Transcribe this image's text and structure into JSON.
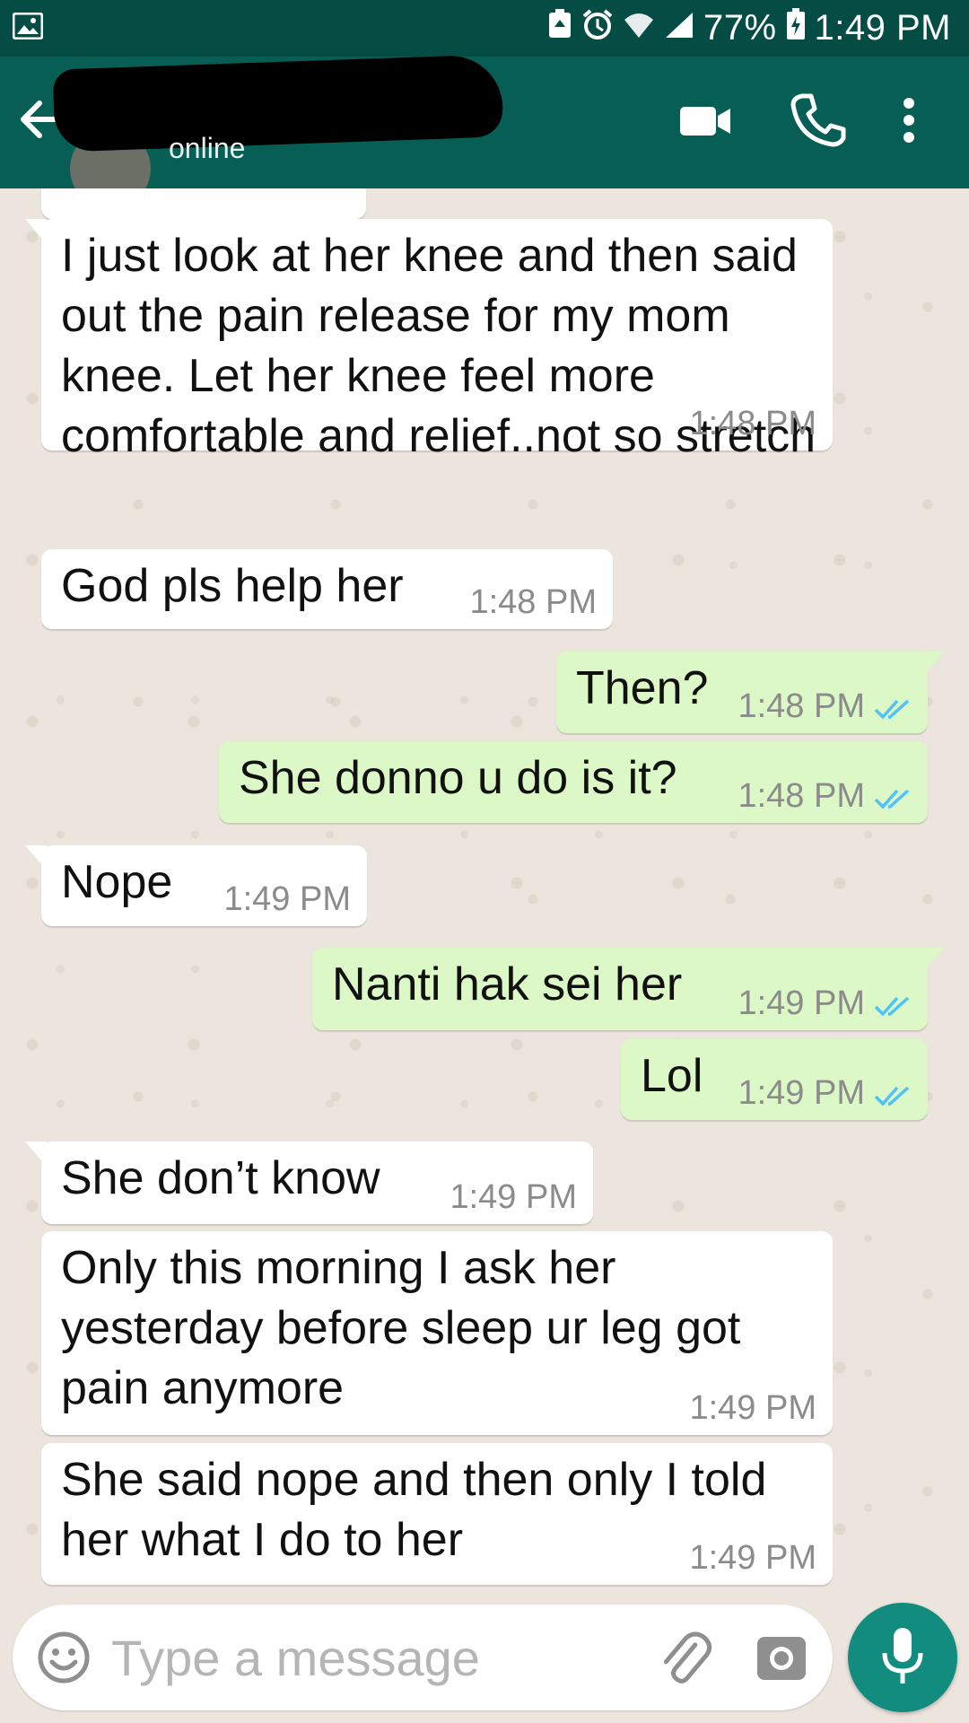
{
  "status_bar": {
    "battery": "77%",
    "time": "1:49 PM"
  },
  "header": {
    "status": "online",
    "icons": [
      "back-arrow-icon",
      "video-call-icon",
      "phone-icon",
      "more-vert-icon"
    ]
  },
  "messages": [
    {
      "direction": "in",
      "text": "I just look at her knee and then said out the pain release for my mom knee. Let her knee feel more comfortable and relief..not so stretch",
      "time": "1:48 PM"
    },
    {
      "direction": "in",
      "text": "God pls help her",
      "time": "1:48 PM"
    },
    {
      "direction": "out",
      "text": "Then?",
      "time": "1:48 PM",
      "ticks": "read"
    },
    {
      "direction": "out",
      "text": "She donno u do is it?",
      "time": "1:48 PM",
      "ticks": "read"
    },
    {
      "direction": "in",
      "text": "Nope",
      "time": "1:49 PM"
    },
    {
      "direction": "out",
      "text": "Nanti hak sei her",
      "time": "1:49 PM",
      "ticks": "read"
    },
    {
      "direction": "out",
      "text": "Lol",
      "time": "1:49 PM",
      "ticks": "read"
    },
    {
      "direction": "in",
      "text": "She don’t know",
      "time": "1:49 PM"
    },
    {
      "direction": "in",
      "text": "Only this morning I ask her yesterday before sleep ur leg got pain anymore",
      "time": "1:49 PM"
    },
    {
      "direction": "in",
      "text": "She said nope and then only I told her what I do to her",
      "time": "1:49 PM"
    }
  ],
  "input": {
    "placeholder": "Type a message",
    "value": ""
  },
  "colors": {
    "status_bar": "#054d44",
    "header": "#075e54",
    "chat_bg": "#ece5dd",
    "incoming_bubble": "#ffffff",
    "outgoing_bubble": "#dcf8c6",
    "read_ticks": "#4fc3f7",
    "mic_button": "#128c7e"
  }
}
